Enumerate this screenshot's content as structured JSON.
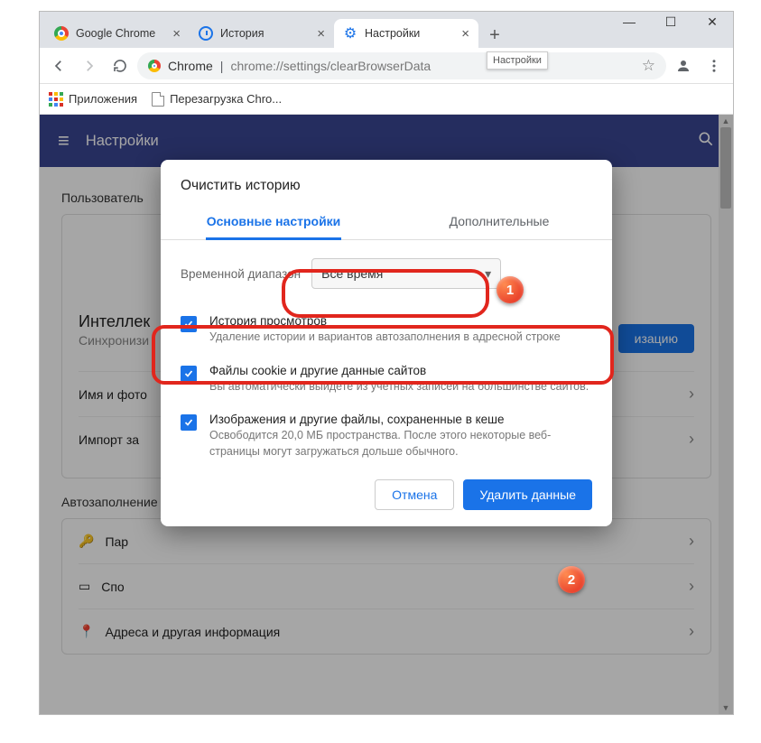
{
  "window": {
    "minimize": "—",
    "maximize": "☐",
    "close": "✕"
  },
  "tabs": {
    "t1": "Google Chrome",
    "t2": "История",
    "t3": "Настройки",
    "tooltip": "Настройки"
  },
  "addressbar": {
    "scheme_label": "Chrome",
    "sep": " | ",
    "path": "chrome://settings/clearBrowserData"
  },
  "bookmarks": {
    "apps": "Приложения",
    "b1": "Перезагрузка Chro..."
  },
  "header": {
    "title": "Настройки"
  },
  "page": {
    "section_users_title": "Пользователь",
    "intel_title": "Интеллек",
    "intel_sub": "Синхронизи",
    "sync_btn": "изацию",
    "row_name": "Имя и фото",
    "row_import": "Импорт за",
    "section_autofill": "Автозаполнение",
    "pw": "Пар",
    "pay": "Спо",
    "addr": "Адреса и другая информация"
  },
  "dialog": {
    "title": "Очистить историю",
    "tab_basic": "Основные настройки",
    "tab_adv": "Дополнительные",
    "range_label": "Временной диапазон",
    "range_value": "Все время",
    "items": [
      {
        "title": "История просмотров",
        "desc": "Удаление истории и вариантов автозаполнения в адресной строке"
      },
      {
        "title": "Файлы cookie и другие данные сайтов",
        "desc": "Вы автоматически выйдете из учетных записей на большинстве сайтов."
      },
      {
        "title": "Изображения и другие файлы, сохраненные в кеше",
        "desc": "Освободится 20,0 МБ пространства. После этого некоторые веб-страницы могут загружаться дольше обычного."
      }
    ],
    "cancel": "Отмена",
    "confirm": "Удалить данные"
  },
  "annotations": {
    "b1": "1",
    "b2": "2"
  }
}
